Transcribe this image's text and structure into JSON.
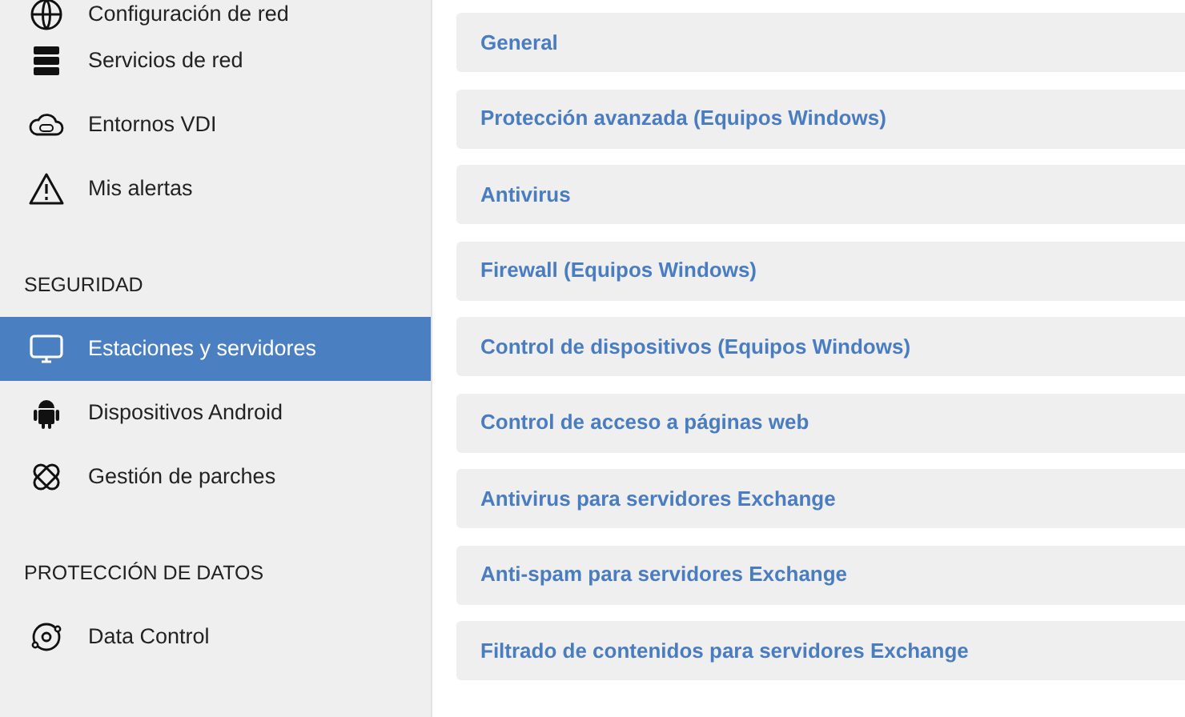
{
  "sidebar": {
    "sections": [
      {
        "items": [
          {
            "label": "Configuración de red",
            "selected": false
          },
          {
            "label": "Servicios de red",
            "selected": false
          },
          {
            "label": "Entornos VDI",
            "selected": false
          },
          {
            "label": "Mis alertas",
            "selected": false
          }
        ]
      },
      {
        "heading": "SEGURIDAD",
        "items": [
          {
            "label": "Estaciones y servidores",
            "selected": true
          },
          {
            "label": "Dispositivos Android",
            "selected": false
          },
          {
            "label": "Gestión de parches",
            "selected": false
          }
        ]
      },
      {
        "heading": "PROTECCIÓN DE DATOS",
        "items": [
          {
            "label": "Data Control",
            "selected": false
          }
        ]
      }
    ]
  },
  "panels": [
    "General",
    "Protección avanzada (Equipos Windows)",
    "Antivirus",
    "Firewall (Equipos Windows)",
    "Control de dispositivos (Equipos Windows)",
    "Control de acceso a páginas web",
    "Antivirus para servidores Exchange",
    "Anti-spam para servidores Exchange",
    "Filtrado de contenidos para servidores Exchange"
  ]
}
